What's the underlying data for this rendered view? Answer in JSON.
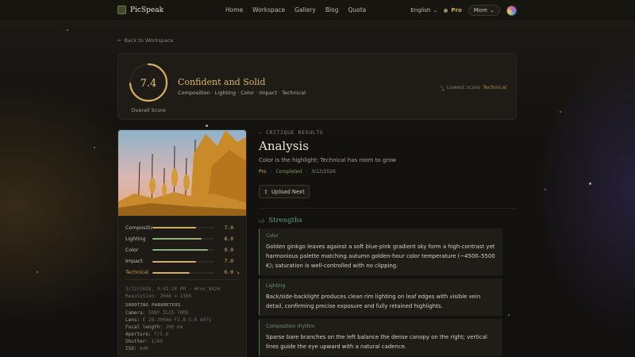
{
  "nav": {
    "brand": "PicSpeak",
    "links": [
      "Home",
      "Workspace",
      "Gallery",
      "Blog",
      "Quota"
    ],
    "language": "English",
    "plan": "Pro",
    "more": "More"
  },
  "back_link": "Back to Workspace",
  "score": {
    "value": "7.4",
    "value_fraction": 0.74,
    "label": "Overall Score",
    "verdict": "Confident and Solid",
    "dimensions": "Composition · Lighting · Color · Impact · Technical",
    "lowest_label": "Lowest score",
    "lowest_value": "Technical"
  },
  "bars": [
    {
      "label": "Composition",
      "value": "7.0",
      "fraction": 0.7,
      "color": "#d4ad5e"
    },
    {
      "label": "Lighting",
      "value": "8.0",
      "fraction": 0.8,
      "color": "#8fb07d"
    },
    {
      "label": "Color",
      "value": "9.0",
      "fraction": 0.9,
      "color": "#8fb07d"
    },
    {
      "label": "Impact",
      "value": "7.0",
      "fraction": 0.7,
      "color": "#d4ad5e"
    },
    {
      "label": "Technical",
      "value": "6.0",
      "fraction": 0.6,
      "color": "#d4ad5e"
    }
  ],
  "meta": {
    "date_line": "3/12/2026, 9:41:28 PM · #rev_8424",
    "resolution": "Resolution: 2048 × 1366",
    "section": "SHOOTING PARAMETERS",
    "params": [
      {
        "k": "Camera:",
        "v": "SONY ILCE-7RM3"
      },
      {
        "k": "Lens:",
        "v": "E 28-200mm F2.8-5.6 A071"
      },
      {
        "k": "Focal length:",
        "v": "200 mm"
      },
      {
        "k": "Aperture:",
        "v": "f/5.6"
      },
      {
        "k": "Shutter:",
        "v": "1/60"
      },
      {
        "k": "ISO:",
        "v": "640"
      }
    ]
  },
  "result": {
    "kicker": "CRITIQUE RESULTS",
    "title": "Analysis",
    "subtitle": "Color is the highlight; Technical has room to grow",
    "status_plan": "Pro",
    "status": "Completed",
    "date": "3/12/2026",
    "upload_label": "Upload Next",
    "strengths_heading": "Strengths",
    "strengths": [
      {
        "tag": "Color",
        "body": "Golden ginkgo leaves against a soft blue-pink gradient sky form a high-contrast yet harmonious palette matching autumn golden-hour color temperature (~4500–5500 K); saturation is well-controlled with no clipping."
      },
      {
        "tag": "Lighting",
        "body": "Back/side-backlight produces clean rim lighting on leaf edges with visible vein detail, confirming precise exposure and fully retained highlights."
      },
      {
        "tag": "Composition rhythm",
        "body": "Sparse bare branches on the left balance the dense canopy on the right; vertical lines guide the eye upward with a natural cadence."
      }
    ]
  }
}
